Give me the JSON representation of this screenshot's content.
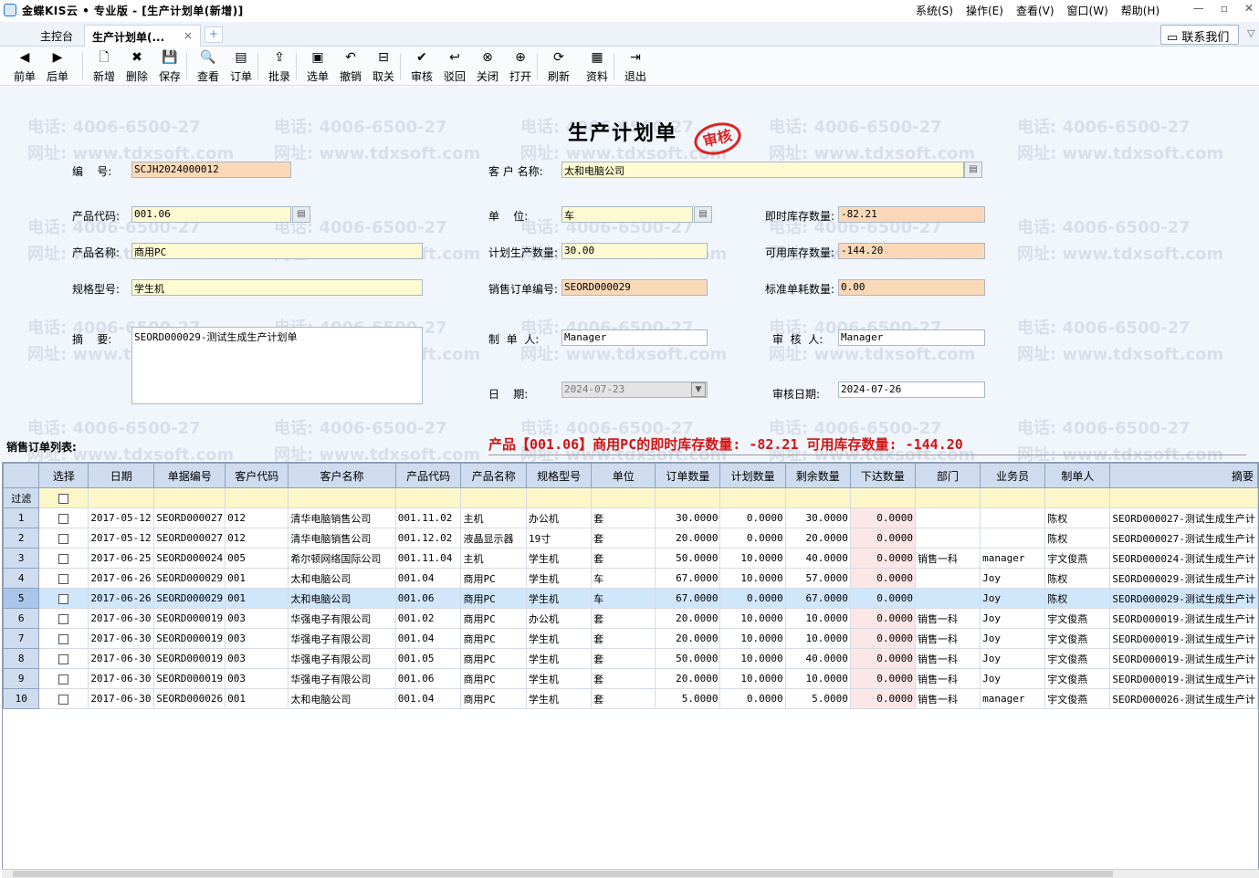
{
  "window": {
    "title": "金蝶KIS云 • 专业版 - [生产计划单(新增)]",
    "menus": [
      "系统(S)",
      "操作(E)",
      "查看(V)",
      "窗口(W)",
      "帮助(H)"
    ],
    "controls": [
      "—",
      "▫",
      "✕"
    ]
  },
  "tabs": {
    "home": "主控台",
    "current": "生产计划单(...",
    "close": "×",
    "add": "+"
  },
  "contact": "联系我们",
  "toolbar": [
    {
      "label": "前单",
      "icon": "◀"
    },
    {
      "label": "后单",
      "icon": "▶"
    },
    {
      "label": "新增",
      "icon": "🗋"
    },
    {
      "label": "删除",
      "icon": "✖"
    },
    {
      "label": "保存",
      "icon": "💾"
    },
    {
      "label": "查看",
      "icon": "🔍"
    },
    {
      "label": "订单",
      "icon": "▤"
    },
    {
      "label": "批录",
      "icon": "⇪"
    },
    {
      "label": "选单",
      "icon": "▣"
    },
    {
      "label": "撤销",
      "icon": "↶"
    },
    {
      "label": "取关",
      "icon": "⊟"
    },
    {
      "label": "审核",
      "icon": "✔"
    },
    {
      "label": "驳回",
      "icon": "↩"
    },
    {
      "label": "关闭",
      "icon": "⊗"
    },
    {
      "label": "打开",
      "icon": "⊕"
    },
    {
      "label": "刷新",
      "icon": "⟳"
    },
    {
      "label": "资料",
      "icon": "▦"
    },
    {
      "label": "退出",
      "icon": "⇥"
    }
  ],
  "watermark": {
    "phone": "电话: 4006-6500-27",
    "site": "网址: www.tdxsoft.com"
  },
  "form": {
    "title": "生产计划单",
    "stamp": "审核",
    "code_label": "编    号:",
    "code": "SCJH2024000012",
    "customer_label": "客 户 名称:",
    "customer": "太和电脑公司",
    "product_code_label": "产品代码:",
    "product_code": "001.06",
    "unit_label": "单    位:",
    "unit": "车",
    "stock_now_label": "即时库存数量:",
    "stock_now": "-82.21",
    "product_name_label": "产品名称:",
    "product_name": "商用PC",
    "plan_qty_label": "计划生产数量:",
    "plan_qty": "30.00",
    "stock_avail_label": "可用库存数量:",
    "stock_avail": "-144.20",
    "spec_label": "规格型号:",
    "spec": "学生机",
    "sales_order_label": "销售订单编号:",
    "sales_order": "SEORD000029",
    "std_consume_label": "标准单耗数量:",
    "std_consume": "0.00",
    "memo_label": "摘    要:",
    "memo": "SEORD000029-测试生成生产计划单",
    "maker_label": "制  单  人:",
    "maker": "Manager",
    "auditor_label": "审  核  人:",
    "auditor": "Manager",
    "date_label": "日    期:",
    "date": "2024-07-23",
    "audit_date_label": "审核日期:",
    "audit_date": "2024-07-26"
  },
  "list": {
    "title": "销售订单列表:",
    "stock_message": "产品【001.06】商用PC的即时库存数量: -82.21  可用库存数量: -144.20",
    "filter_label": "过滤",
    "columns": [
      "选择",
      "日期",
      "单据编号",
      "客户代码",
      "客户名称",
      "产品代码",
      "产品名称",
      "规格型号",
      "单位",
      "订单数量",
      "计划数量",
      "剩余数量",
      "下达数量",
      "部门",
      "业务员",
      "制单人",
      "摘要"
    ],
    "rows": [
      [
        "1",
        "2017-05-12",
        "SEORD000027",
        "012",
        "清华电脑销售公司",
        "001.11.02",
        "主机",
        "办公机",
        "套",
        "30.0000",
        "0.0000",
        "30.0000",
        "0.0000",
        "",
        "",
        "陈权",
        "SEORD000027-测试生成生产计"
      ],
      [
        "2",
        "2017-05-12",
        "SEORD000027",
        "012",
        "清华电脑销售公司",
        "001.12.02",
        "液晶显示器",
        "19寸",
        "套",
        "20.0000",
        "0.0000",
        "20.0000",
        "0.0000",
        "",
        "",
        "陈权",
        "SEORD000027-测试生成生产计"
      ],
      [
        "3",
        "2017-06-25",
        "SEORD000024",
        "005",
        "希尔顿网络国际公司",
        "001.11.04",
        "主机",
        "学生机",
        "套",
        "50.0000",
        "10.0000",
        "40.0000",
        "0.0000",
        "销售一科",
        "manager",
        "宇文俊燕",
        "SEORD000024-测试生成生产计"
      ],
      [
        "4",
        "2017-06-26",
        "SEORD000029",
        "001",
        "太和电脑公司",
        "001.04",
        "商用PC",
        "学生机",
        "车",
        "67.0000",
        "10.0000",
        "57.0000",
        "0.0000",
        "",
        "Joy",
        "陈权",
        "SEORD000029-测试生成生产计"
      ],
      [
        "5",
        "2017-06-26",
        "SEORD000029",
        "001",
        "太和电脑公司",
        "001.06",
        "商用PC",
        "学生机",
        "车",
        "67.0000",
        "0.0000",
        "67.0000",
        "0.0000",
        "",
        "Joy",
        "陈权",
        "SEORD000029-测试生成生产计"
      ],
      [
        "6",
        "2017-06-30",
        "SEORD000019",
        "003",
        "华强电子有限公司",
        "001.02",
        "商用PC",
        "办公机",
        "套",
        "20.0000",
        "10.0000",
        "10.0000",
        "0.0000",
        "销售一科",
        "Joy",
        "宇文俊燕",
        "SEORD000019-测试生成生产计"
      ],
      [
        "7",
        "2017-06-30",
        "SEORD000019",
        "003",
        "华强电子有限公司",
        "001.04",
        "商用PC",
        "学生机",
        "套",
        "20.0000",
        "10.0000",
        "10.0000",
        "0.0000",
        "销售一科",
        "Joy",
        "宇文俊燕",
        "SEORD000019-测试生成生产计"
      ],
      [
        "8",
        "2017-06-30",
        "SEORD000019",
        "003",
        "华强电子有限公司",
        "001.05",
        "商用PC",
        "学生机",
        "套",
        "50.0000",
        "10.0000",
        "40.0000",
        "0.0000",
        "销售一科",
        "Joy",
        "宇文俊燕",
        "SEORD000019-测试生成生产计"
      ],
      [
        "9",
        "2017-06-30",
        "SEORD000019",
        "003",
        "华强电子有限公司",
        "001.06",
        "商用PC",
        "学生机",
        "套",
        "20.0000",
        "10.0000",
        "10.0000",
        "0.0000",
        "销售一科",
        "Joy",
        "宇文俊燕",
        "SEORD000019-测试生成生产计"
      ],
      [
        "10",
        "2017-06-30",
        "SEORD000026",
        "001",
        "太和电脑公司",
        "001.04",
        "商用PC",
        "学生机",
        "套",
        "5.0000",
        "0.0000",
        "5.0000",
        "0.0000",
        "销售一科",
        "manager",
        "宇文俊燕",
        "SEORD000026-测试生成生产计"
      ]
    ],
    "selected_row": 5
  },
  "colors": {
    "form_bg": "#f1f6fd",
    "input_yellow": "#fefbd2",
    "input_orange": "#fbd9b8",
    "header_blue": "#cfdcef",
    "selected_row": "#cfe6fb",
    "stamp_red": "#dd2222",
    "message_red": "#d01515"
  }
}
